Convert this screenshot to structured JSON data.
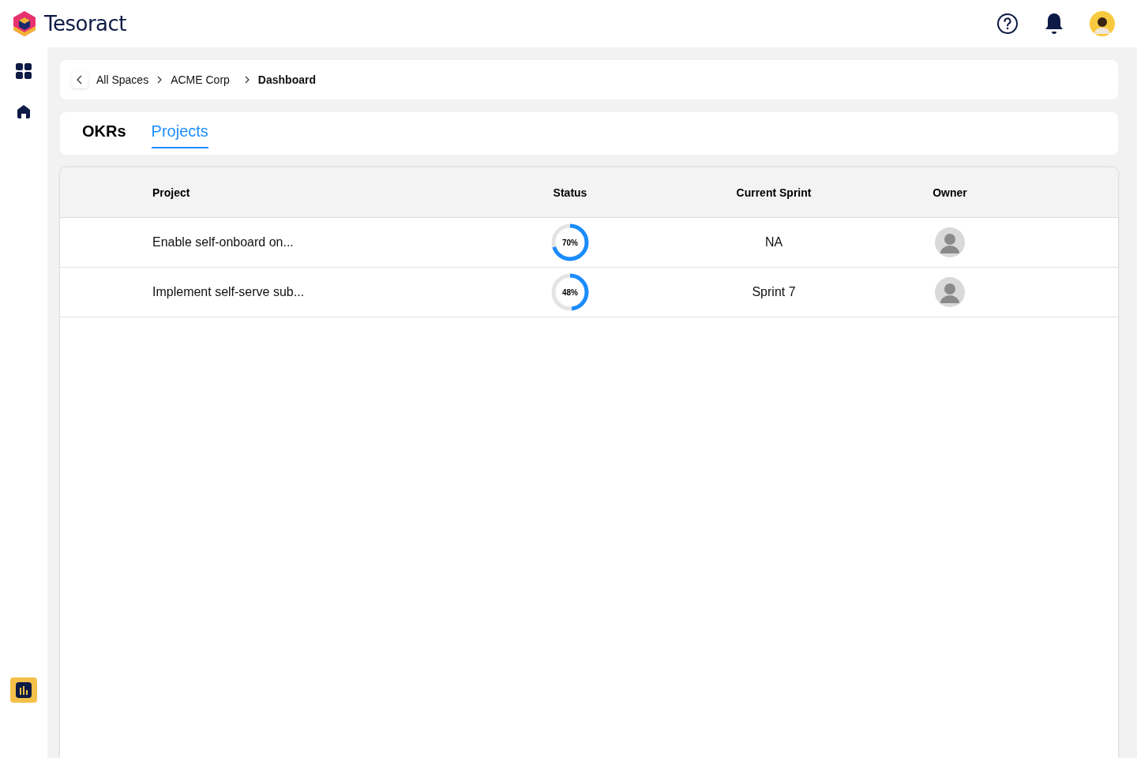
{
  "app": {
    "name": "Tesoract"
  },
  "breadcrumb": [
    {
      "label": "All Spaces",
      "current": false
    },
    {
      "label": "ACME Corp",
      "current": false
    },
    {
      "label": "Dashboard",
      "current": true
    }
  ],
  "tabs": [
    {
      "label": "OKRs",
      "selected": false
    },
    {
      "label": "Projects",
      "selected": true
    }
  ],
  "table": {
    "columns": [
      "Project",
      "Status",
      "Current Sprint",
      "Owner"
    ],
    "rows": [
      {
        "project": "Enable self-onboard on...",
        "status": {
          "label": "70%",
          "level": 0.7
        },
        "sprint": "NA"
      },
      {
        "project": "Implement self-serve sub...",
        "status": {
          "label": "48%",
          "level": 0.48
        },
        "sprint": "Sprint 7"
      }
    ]
  }
}
